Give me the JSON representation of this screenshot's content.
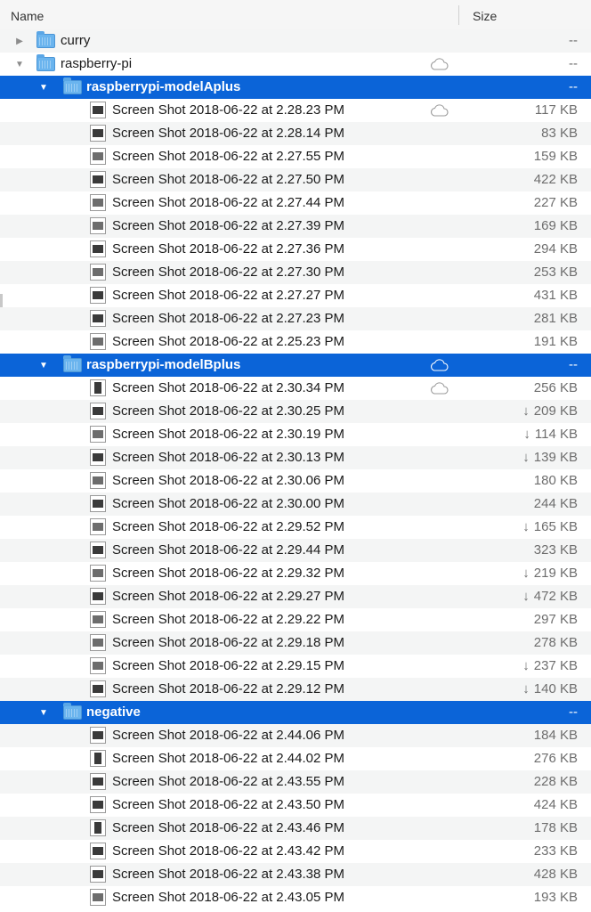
{
  "header": {
    "name_label": "Name",
    "size_label": "Size"
  },
  "colors": {
    "selection": "#0b64d8",
    "alt_row": "#f4f5f5",
    "folder": "#6ab4ee"
  },
  "rows": [
    {
      "type": "folder",
      "level": 0,
      "expanded": false,
      "name": "curry",
      "size": "--",
      "cloud": false,
      "selected": false
    },
    {
      "type": "folder",
      "level": 0,
      "expanded": true,
      "name": "raspberry-pi",
      "size": "--",
      "cloud": true,
      "selected": false
    },
    {
      "type": "folder",
      "level": 1,
      "expanded": true,
      "name": "raspberrypi-modelAplus",
      "size": "--",
      "cloud": false,
      "selected": true
    },
    {
      "type": "file",
      "level": 2,
      "name": "Screen Shot 2018-06-22 at 2.28.23 PM",
      "size": "117 KB",
      "cloud": true,
      "download": false,
      "thumb": "dark"
    },
    {
      "type": "file",
      "level": 2,
      "name": "Screen Shot 2018-06-22 at 2.28.14 PM",
      "size": "83 KB",
      "cloud": false,
      "download": false,
      "thumb": "dark"
    },
    {
      "type": "file",
      "level": 2,
      "name": "Screen Shot 2018-06-22 at 2.27.55 PM",
      "size": "159 KB",
      "cloud": false,
      "download": false,
      "thumb": "light"
    },
    {
      "type": "file",
      "level": 2,
      "name": "Screen Shot 2018-06-22 at 2.27.50 PM",
      "size": "422 KB",
      "cloud": false,
      "download": false,
      "thumb": "dark"
    },
    {
      "type": "file",
      "level": 2,
      "name": "Screen Shot 2018-06-22 at 2.27.44 PM",
      "size": "227 KB",
      "cloud": false,
      "download": false,
      "thumb": "light"
    },
    {
      "type": "file",
      "level": 2,
      "name": "Screen Shot 2018-06-22 at 2.27.39 PM",
      "size": "169 KB",
      "cloud": false,
      "download": false,
      "thumb": "light"
    },
    {
      "type": "file",
      "level": 2,
      "name": "Screen Shot 2018-06-22 at 2.27.36 PM",
      "size": "294 KB",
      "cloud": false,
      "download": false,
      "thumb": "dark"
    },
    {
      "type": "file",
      "level": 2,
      "name": "Screen Shot 2018-06-22 at 2.27.30 PM",
      "size": "253 KB",
      "cloud": false,
      "download": false,
      "thumb": "light"
    },
    {
      "type": "file",
      "level": 2,
      "name": "Screen Shot 2018-06-22 at 2.27.27 PM",
      "size": "431 KB",
      "cloud": false,
      "download": false,
      "thumb": "dark"
    },
    {
      "type": "file",
      "level": 2,
      "name": "Screen Shot 2018-06-22 at 2.27.23 PM",
      "size": "281 KB",
      "cloud": false,
      "download": false,
      "thumb": "dark"
    },
    {
      "type": "file",
      "level": 2,
      "name": "Screen Shot 2018-06-22 at 2.25.23 PM",
      "size": "191 KB",
      "cloud": false,
      "download": false,
      "thumb": "light"
    },
    {
      "type": "folder",
      "level": 1,
      "expanded": true,
      "name": "raspberrypi-modelBplus",
      "size": "--",
      "cloud": true,
      "selected": true
    },
    {
      "type": "file",
      "level": 2,
      "name": "Screen Shot 2018-06-22 at 2.30.34 PM",
      "size": "256 KB",
      "cloud": true,
      "download": false,
      "thumb": "tall"
    },
    {
      "type": "file",
      "level": 2,
      "name": "Screen Shot 2018-06-22 at 2.30.25 PM",
      "size": "209 KB",
      "cloud": false,
      "download": true,
      "thumb": "dark"
    },
    {
      "type": "file",
      "level": 2,
      "name": "Screen Shot 2018-06-22 at 2.30.19 PM",
      "size": "114 KB",
      "cloud": false,
      "download": true,
      "thumb": "light"
    },
    {
      "type": "file",
      "level": 2,
      "name": "Screen Shot 2018-06-22 at 2.30.13 PM",
      "size": "139 KB",
      "cloud": false,
      "download": true,
      "thumb": "dark"
    },
    {
      "type": "file",
      "level": 2,
      "name": "Screen Shot 2018-06-22 at 2.30.06 PM",
      "size": "180 KB",
      "cloud": false,
      "download": false,
      "thumb": "light"
    },
    {
      "type": "file",
      "level": 2,
      "name": "Screen Shot 2018-06-22 at 2.30.00 PM",
      "size": "244 KB",
      "cloud": false,
      "download": false,
      "thumb": "dark"
    },
    {
      "type": "file",
      "level": 2,
      "name": "Screen Shot 2018-06-22 at 2.29.52 PM",
      "size": "165 KB",
      "cloud": false,
      "download": true,
      "thumb": "light"
    },
    {
      "type": "file",
      "level": 2,
      "name": "Screen Shot 2018-06-22 at 2.29.44 PM",
      "size": "323 KB",
      "cloud": false,
      "download": false,
      "thumb": "dark"
    },
    {
      "type": "file",
      "level": 2,
      "name": "Screen Shot 2018-06-22 at 2.29.32 PM",
      "size": "219 KB",
      "cloud": false,
      "download": true,
      "thumb": "light"
    },
    {
      "type": "file",
      "level": 2,
      "name": "Screen Shot 2018-06-22 at 2.29.27 PM",
      "size": "472 KB",
      "cloud": false,
      "download": true,
      "thumb": "dark"
    },
    {
      "type": "file",
      "level": 2,
      "name": "Screen Shot 2018-06-22 at 2.29.22 PM",
      "size": "297 KB",
      "cloud": false,
      "download": false,
      "thumb": "light"
    },
    {
      "type": "file",
      "level": 2,
      "name": "Screen Shot 2018-06-22 at 2.29.18 PM",
      "size": "278 KB",
      "cloud": false,
      "download": false,
      "thumb": "light"
    },
    {
      "type": "file",
      "level": 2,
      "name": "Screen Shot 2018-06-22 at 2.29.15 PM",
      "size": "237 KB",
      "cloud": false,
      "download": true,
      "thumb": "light"
    },
    {
      "type": "file",
      "level": 2,
      "name": "Screen Shot 2018-06-22 at 2.29.12 PM",
      "size": "140 KB",
      "cloud": false,
      "download": true,
      "thumb": "dark"
    },
    {
      "type": "folder",
      "level": 1,
      "expanded": true,
      "name": "negative",
      "size": "--",
      "cloud": false,
      "selected": true
    },
    {
      "type": "file",
      "level": 2,
      "name": "Screen Shot 2018-06-22 at 2.44.06 PM",
      "size": "184 KB",
      "cloud": false,
      "download": false,
      "thumb": "dark"
    },
    {
      "type": "file",
      "level": 2,
      "name": "Screen Shot 2018-06-22 at 2.44.02 PM",
      "size": "276 KB",
      "cloud": false,
      "download": false,
      "thumb": "tall"
    },
    {
      "type": "file",
      "level": 2,
      "name": "Screen Shot 2018-06-22 at 2.43.55 PM",
      "size": "228 KB",
      "cloud": false,
      "download": false,
      "thumb": "dark"
    },
    {
      "type": "file",
      "level": 2,
      "name": "Screen Shot 2018-06-22 at 2.43.50 PM",
      "size": "424 KB",
      "cloud": false,
      "download": false,
      "thumb": "dark"
    },
    {
      "type": "file",
      "level": 2,
      "name": "Screen Shot 2018-06-22 at 2.43.46 PM",
      "size": "178 KB",
      "cloud": false,
      "download": false,
      "thumb": "tall"
    },
    {
      "type": "file",
      "level": 2,
      "name": "Screen Shot 2018-06-22 at 2.43.42 PM",
      "size": "233 KB",
      "cloud": false,
      "download": false,
      "thumb": "dark"
    },
    {
      "type": "file",
      "level": 2,
      "name": "Screen Shot 2018-06-22 at 2.43.38 PM",
      "size": "428 KB",
      "cloud": false,
      "download": false,
      "thumb": "dark"
    },
    {
      "type": "file",
      "level": 2,
      "name": "Screen Shot 2018-06-22 at 2.43.05 PM",
      "size": "193 KB",
      "cloud": false,
      "download": false,
      "thumb": "light"
    }
  ]
}
